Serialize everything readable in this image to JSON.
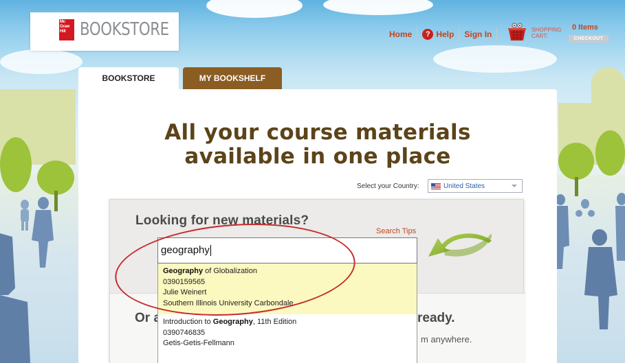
{
  "header": {
    "logo_text": "Mc Graw Hill",
    "brand": "BOOKSTORE",
    "nav": {
      "home": "Home",
      "help": "Help",
      "help_icon": "?",
      "signin": "Sign In"
    },
    "cart": {
      "label_line1": "SHOPPING",
      "label_line2": "CART:",
      "items": "0 Items",
      "checkout": "CHECKOUT"
    }
  },
  "tabs": [
    {
      "label": "BOOKSTORE",
      "active": true
    },
    {
      "label": "MY BOOKSHELF",
      "active": false
    }
  ],
  "hero": {
    "line1": "All your course materials",
    "line2": "available in one place"
  },
  "country": {
    "label": "Select your Country:",
    "selected": "United States"
  },
  "search": {
    "heading": "Looking for new materials?",
    "tips": "Search Tips",
    "value": "geography"
  },
  "suggestions": [
    {
      "title_bold": "Geography",
      "title_rest": " of Globalization",
      "isbn": "0390159565",
      "author": "Julie Weinert",
      "school": "Southern Illinois University Carbondale"
    },
    {
      "title_pre": "Introduction to ",
      "title_bold": "Geography",
      "title_rest": ", 11th Edition",
      "isbn": "0390746835",
      "author": "Getis-Getis-Fellmann"
    }
  ],
  "lower": {
    "or_text": "Or a",
    "ready_text": "ready.",
    "anywhere_text": "m anywhere."
  },
  "colors": {
    "accent": "#c1461e",
    "brown": "#5c4319",
    "tab_brown": "#8b5d22",
    "highlight": "#fbf8c0"
  }
}
